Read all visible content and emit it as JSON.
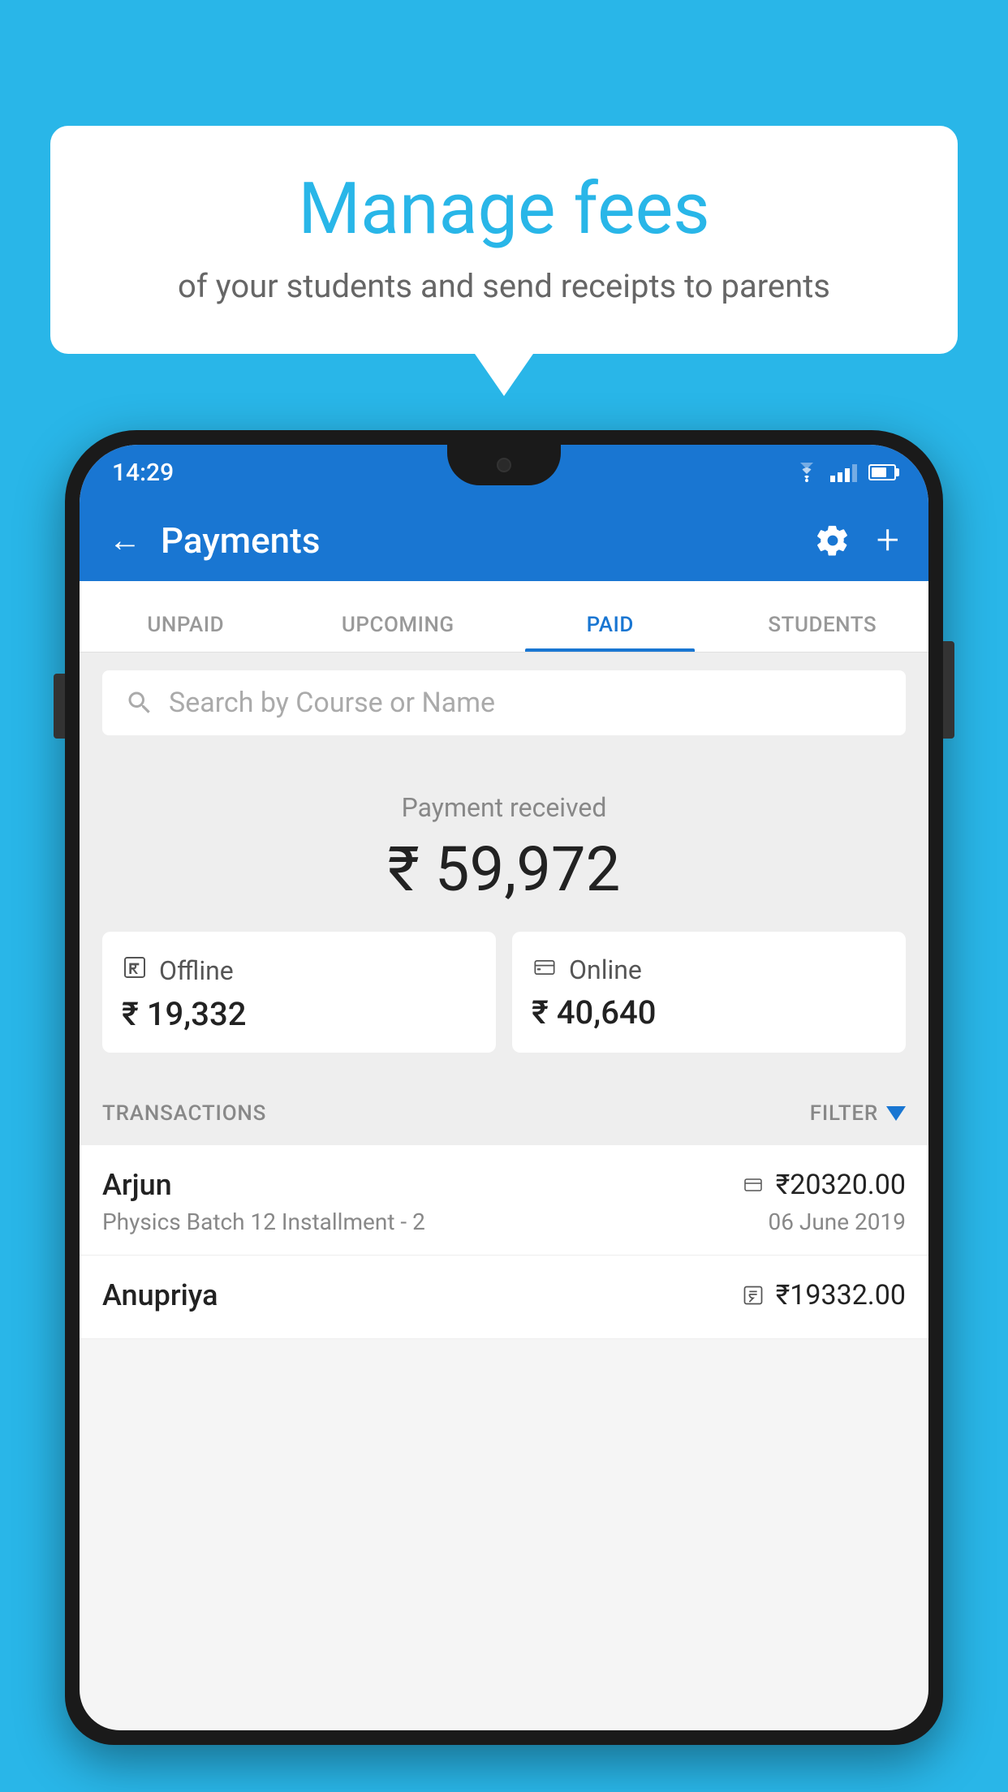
{
  "background_color": "#29b6e8",
  "speech_bubble": {
    "title": "Manage fees",
    "subtitle": "of your students and send receipts to parents"
  },
  "status_bar": {
    "time": "14:29"
  },
  "app_header": {
    "title": "Payments",
    "back_label": "←",
    "plus_label": "+"
  },
  "tabs": [
    {
      "label": "UNPAID",
      "active": false
    },
    {
      "label": "UPCOMING",
      "active": false
    },
    {
      "label": "PAID",
      "active": true
    },
    {
      "label": "STUDENTS",
      "active": false
    }
  ],
  "search": {
    "placeholder": "Search by Course or Name"
  },
  "payment_received": {
    "label": "Payment received",
    "amount": "₹ 59,972",
    "offline": {
      "type": "Offline",
      "amount": "₹ 19,332"
    },
    "online": {
      "type": "Online",
      "amount": "₹ 40,640"
    }
  },
  "transactions_section": {
    "label": "TRANSACTIONS",
    "filter_label": "FILTER"
  },
  "transactions": [
    {
      "name": "Arjun",
      "course": "Physics Batch 12 Installment - 2",
      "amount": "₹20320.00",
      "date": "06 June 2019",
      "payment_type": "online"
    },
    {
      "name": "Anupriya",
      "course": "",
      "amount": "₹19332.00",
      "date": "",
      "payment_type": "offline"
    }
  ]
}
